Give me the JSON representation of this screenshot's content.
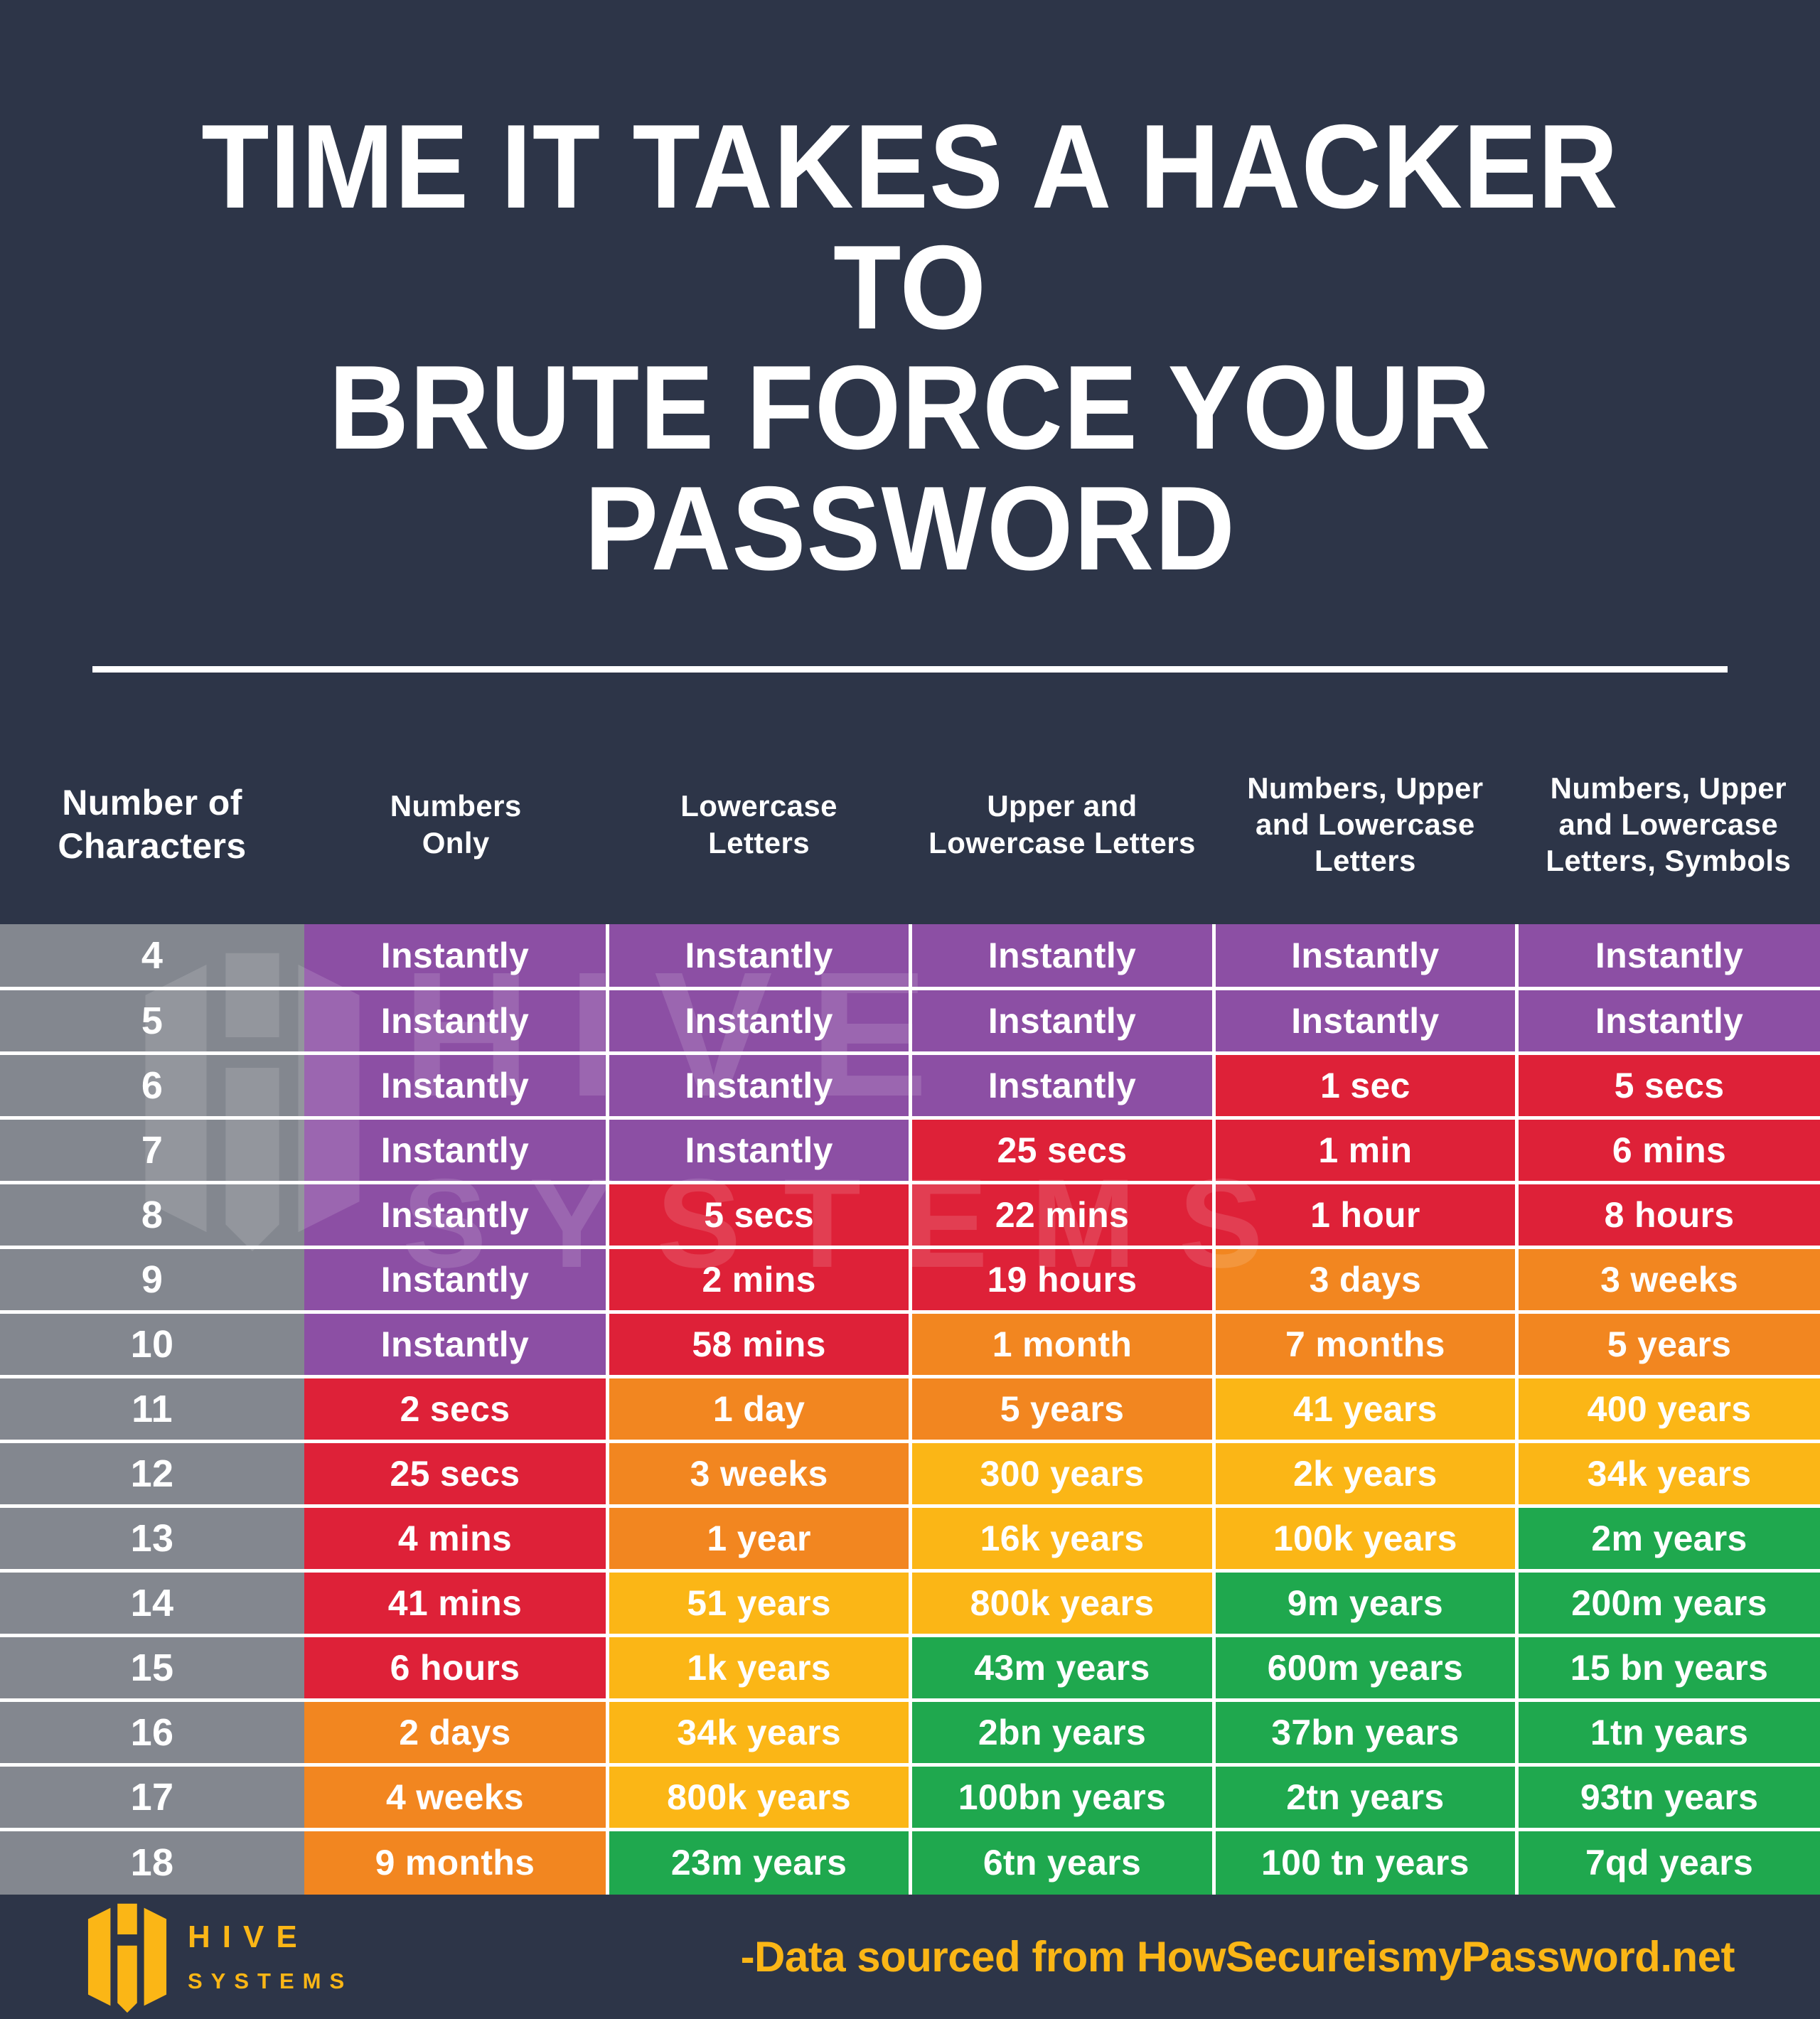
{
  "poster": {
    "title": "TIME IT TAKES A HACKER TO\nBRUTE FORCE YOUR PASSWORD",
    "background_color": "#2d3548"
  },
  "watermark": {
    "line1": "HIVE",
    "line2": "SYSTEMS"
  },
  "footer": {
    "logo_line1": "HIVE",
    "logo_line2": "SYSTEMS",
    "source_text": "-Data sourced from HowSecureismyPassword.net",
    "accent_color": "#fbb616"
  },
  "legend_colors": {
    "instant_gray": "#83878f",
    "purple": "#8c4fa4",
    "red": "#de2138",
    "orange": "#f28620",
    "amber": "#fbb616",
    "green": "#1fa84e"
  },
  "chart_data": {
    "type": "heatmap",
    "title": "TIME IT TAKES A HACKER TO BRUTE FORCE YOUR PASSWORD",
    "xlabel": "",
    "ylabel": "Number of Characters",
    "grid": true,
    "legend_position": "none",
    "columns": [
      "Number of\nCharacters",
      "Numbers\nOnly",
      "Lowercase\nLetters",
      "Upper and\nLowercase Letters",
      "Numbers, Upper\nand Lowercase\nLetters",
      "Numbers, Upper\nand Lowercase\nLetters, Symbols"
    ],
    "categories": [
      "4",
      "5",
      "6",
      "7",
      "8",
      "9",
      "10",
      "11",
      "12",
      "13",
      "14",
      "15",
      "16",
      "17",
      "18"
    ],
    "rows": [
      {
        "chars": "4",
        "cells": [
          {
            "text": "Instantly",
            "color": "purple"
          },
          {
            "text": "Instantly",
            "color": "purple"
          },
          {
            "text": "Instantly",
            "color": "purple"
          },
          {
            "text": "Instantly",
            "color": "purple"
          },
          {
            "text": "Instantly",
            "color": "purple"
          }
        ]
      },
      {
        "chars": "5",
        "cells": [
          {
            "text": "Instantly",
            "color": "purple"
          },
          {
            "text": "Instantly",
            "color": "purple"
          },
          {
            "text": "Instantly",
            "color": "purple"
          },
          {
            "text": "Instantly",
            "color": "purple"
          },
          {
            "text": "Instantly",
            "color": "purple"
          }
        ]
      },
      {
        "chars": "6",
        "cells": [
          {
            "text": "Instantly",
            "color": "purple"
          },
          {
            "text": "Instantly",
            "color": "purple"
          },
          {
            "text": "Instantly",
            "color": "purple"
          },
          {
            "text": "1 sec",
            "color": "red"
          },
          {
            "text": "5 secs",
            "color": "red"
          }
        ]
      },
      {
        "chars": "7",
        "cells": [
          {
            "text": "Instantly",
            "color": "purple"
          },
          {
            "text": "Instantly",
            "color": "purple"
          },
          {
            "text": "25 secs",
            "color": "red"
          },
          {
            "text": "1 min",
            "color": "red"
          },
          {
            "text": "6 mins",
            "color": "red"
          }
        ]
      },
      {
        "chars": "8",
        "cells": [
          {
            "text": "Instantly",
            "color": "purple"
          },
          {
            "text": "5 secs",
            "color": "red"
          },
          {
            "text": "22 mins",
            "color": "red"
          },
          {
            "text": "1 hour",
            "color": "red"
          },
          {
            "text": "8 hours",
            "color": "red"
          }
        ]
      },
      {
        "chars": "9",
        "cells": [
          {
            "text": "Instantly",
            "color": "purple"
          },
          {
            "text": "2 mins",
            "color": "red"
          },
          {
            "text": "19 hours",
            "color": "red"
          },
          {
            "text": "3 days",
            "color": "orange"
          },
          {
            "text": "3 weeks",
            "color": "orange"
          }
        ]
      },
      {
        "chars": "10",
        "cells": [
          {
            "text": "Instantly",
            "color": "purple"
          },
          {
            "text": "58 mins",
            "color": "red"
          },
          {
            "text": "1 month",
            "color": "orange"
          },
          {
            "text": "7 months",
            "color": "orange"
          },
          {
            "text": "5 years",
            "color": "orange"
          }
        ]
      },
      {
        "chars": "11",
        "cells": [
          {
            "text": "2 secs",
            "color": "red"
          },
          {
            "text": "1 day",
            "color": "orange"
          },
          {
            "text": "5 years",
            "color": "orange"
          },
          {
            "text": "41 years",
            "color": "amber"
          },
          {
            "text": "400 years",
            "color": "amber"
          }
        ]
      },
      {
        "chars": "12",
        "cells": [
          {
            "text": "25 secs",
            "color": "red"
          },
          {
            "text": "3 weeks",
            "color": "orange"
          },
          {
            "text": "300 years",
            "color": "amber"
          },
          {
            "text": "2k years",
            "color": "amber"
          },
          {
            "text": "34k years",
            "color": "amber"
          }
        ]
      },
      {
        "chars": "13",
        "cells": [
          {
            "text": "4 mins",
            "color": "red"
          },
          {
            "text": "1 year",
            "color": "orange"
          },
          {
            "text": "16k years",
            "color": "amber"
          },
          {
            "text": "100k years",
            "color": "amber"
          },
          {
            "text": "2m years",
            "color": "green"
          }
        ]
      },
      {
        "chars": "14",
        "cells": [
          {
            "text": "41 mins",
            "color": "red"
          },
          {
            "text": "51 years",
            "color": "amber"
          },
          {
            "text": "800k years",
            "color": "amber"
          },
          {
            "text": "9m years",
            "color": "green"
          },
          {
            "text": "200m years",
            "color": "green"
          }
        ]
      },
      {
        "chars": "15",
        "cells": [
          {
            "text": "6 hours",
            "color": "red"
          },
          {
            "text": "1k years",
            "color": "amber"
          },
          {
            "text": "43m years",
            "color": "green"
          },
          {
            "text": "600m years",
            "color": "green"
          },
          {
            "text": "15 bn years",
            "color": "green"
          }
        ]
      },
      {
        "chars": "16",
        "cells": [
          {
            "text": "2 days",
            "color": "orange"
          },
          {
            "text": "34k years",
            "color": "amber"
          },
          {
            "text": "2bn years",
            "color": "green"
          },
          {
            "text": "37bn years",
            "color": "green"
          },
          {
            "text": "1tn years",
            "color": "green"
          }
        ]
      },
      {
        "chars": "17",
        "cells": [
          {
            "text": "4 weeks",
            "color": "orange"
          },
          {
            "text": "800k years",
            "color": "amber"
          },
          {
            "text": "100bn years",
            "color": "green"
          },
          {
            "text": "2tn years",
            "color": "green"
          },
          {
            "text": "93tn years",
            "color": "green"
          }
        ]
      },
      {
        "chars": "18",
        "cells": [
          {
            "text": "9 months",
            "color": "orange"
          },
          {
            "text": "23m years",
            "color": "green"
          },
          {
            "text": "6tn years",
            "color": "green"
          },
          {
            "text": "100 tn years",
            "color": "green"
          },
          {
            "text": "7qd years",
            "color": "green"
          }
        ]
      }
    ]
  }
}
